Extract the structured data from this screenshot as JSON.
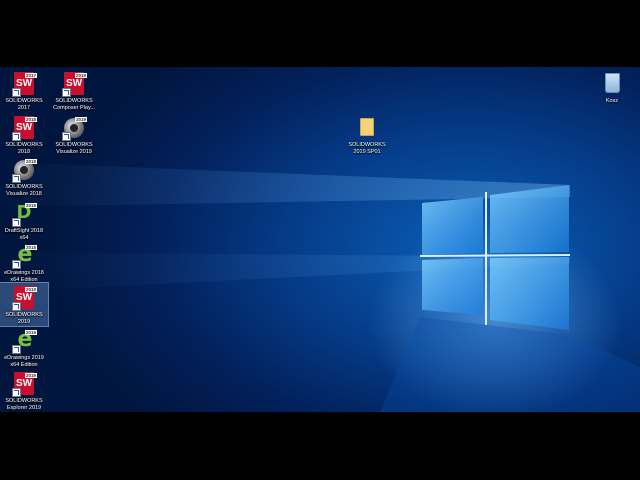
{
  "desktop": {
    "icons": [
      {
        "label": "SOLIDWORKS 2017",
        "type": "sw",
        "version": "2017"
      },
      {
        "label": "SOLIDWORKS Composer Play...",
        "type": "sw",
        "version": "2019"
      },
      {
        "label": "SOLIDWORKS 2018",
        "type": "sw",
        "version": "2018"
      },
      {
        "label": "SOLIDWORKS Visualize 2019",
        "type": "viz",
        "version": "2019"
      },
      {
        "label": "SOLIDWORKS Visualize 2018",
        "type": "viz",
        "version": "2018"
      },
      {
        "label": "DraftSight 2018 x64",
        "type": "ds",
        "version": "2018"
      },
      {
        "label": "eDrawings 2018 x64 Edition",
        "type": "ed",
        "version": "2018"
      },
      {
        "label": "SOLIDWORKS 2019",
        "type": "sw",
        "version": "2019"
      },
      {
        "label": "eDrawings 2019 x64 Edition",
        "type": "ed",
        "version": "2019"
      },
      {
        "label": "SOLIDWORKS Explorer 2019",
        "type": "sw",
        "version": "2019"
      },
      {
        "label": "SOLIDWORKS 2019 SP01",
        "type": "folder"
      },
      {
        "label": "Kosz",
        "type": "bin"
      }
    ]
  }
}
